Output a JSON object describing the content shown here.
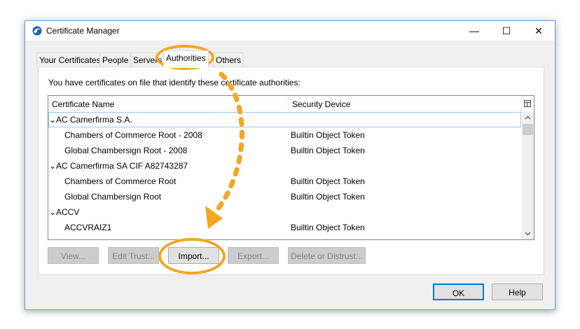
{
  "window": {
    "title": "Certificate Manager",
    "minimize": "—",
    "maximize": "☐",
    "close": "✕"
  },
  "tabs": [
    {
      "label": "Your Certificates",
      "active": false
    },
    {
      "label": "People",
      "active": false
    },
    {
      "label": "Servers",
      "active": false
    },
    {
      "label": "Authorities",
      "active": true
    },
    {
      "label": "Others",
      "active": false
    }
  ],
  "panel": {
    "description": "You have certificates on file that identify these certificate authorities:"
  },
  "tree": {
    "columns": [
      "Certificate Name",
      "Security Device"
    ],
    "rows": [
      {
        "name": "AC Camerfirma S.A.",
        "device": "",
        "group": true,
        "selected": true
      },
      {
        "name": "Chambers of Commerce Root - 2008",
        "device": "Builtin Object Token",
        "group": false
      },
      {
        "name": "Global Chambersign Root - 2008",
        "device": "Builtin Object Token",
        "group": false
      },
      {
        "name": "AC Camerfirma SA CIF A82743287",
        "device": "",
        "group": true
      },
      {
        "name": "Chambers of Commerce Root",
        "device": "Builtin Object Token",
        "group": false
      },
      {
        "name": "Global Chambersign Root",
        "device": "Builtin Object Token",
        "group": false
      },
      {
        "name": "ACCV",
        "device": "",
        "group": true
      },
      {
        "name": "ACCVRAIZ1",
        "device": "Builtin Object Token",
        "group": false
      }
    ]
  },
  "buttons": {
    "view": "View...",
    "edit_trust": "Edit Trust...",
    "import": "Import...",
    "export": "Export...",
    "delete": "Delete or Distrust...",
    "ok": "OK",
    "help": "Help"
  },
  "colors": {
    "accent": "#0078d7",
    "callout": "#f5a623",
    "window_border": "#6a9ad6"
  }
}
